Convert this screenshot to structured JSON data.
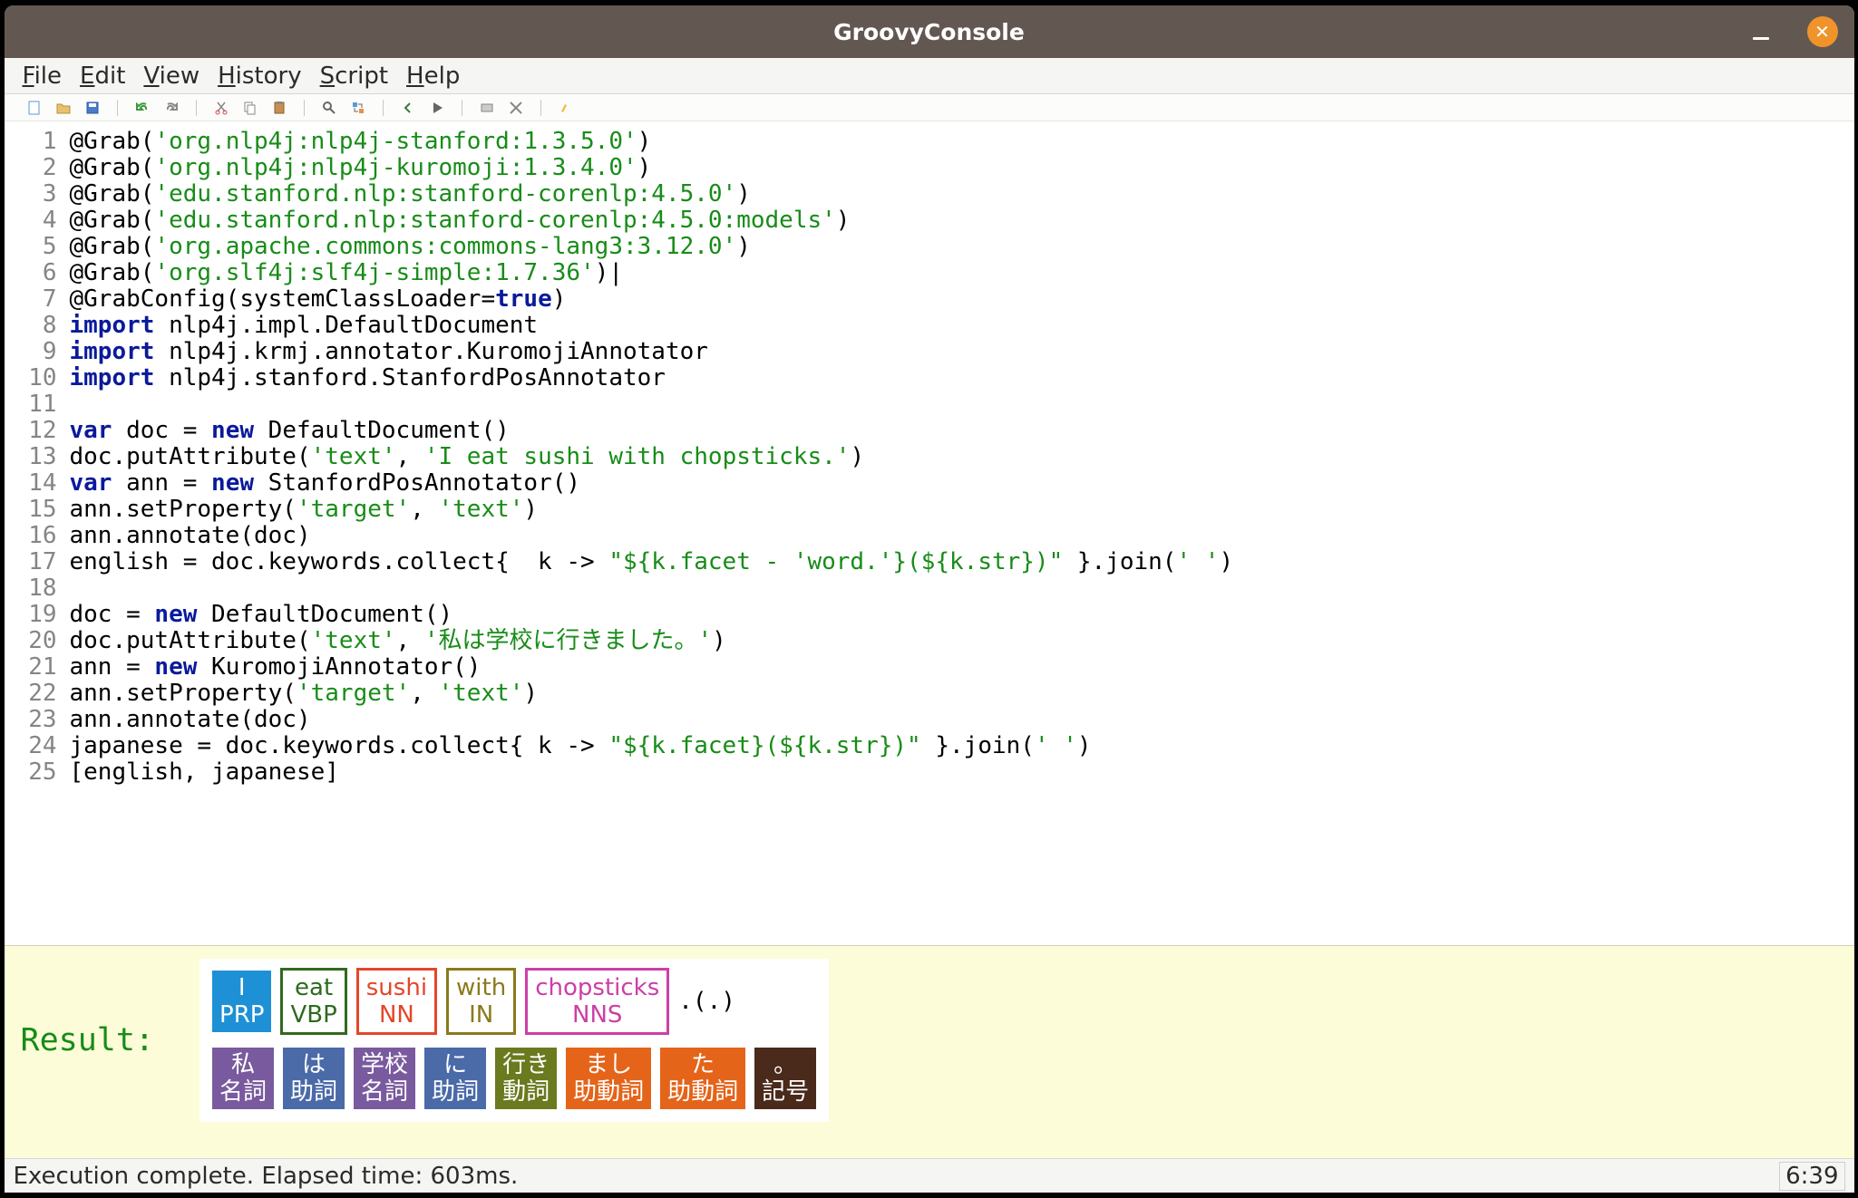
{
  "window": {
    "title": "GroovyConsole"
  },
  "menu": {
    "file": "File",
    "edit": "Edit",
    "view": "View",
    "history": "History",
    "script": "Script",
    "help": "Help"
  },
  "toolbar_icons": [
    "new",
    "open",
    "save",
    "undo",
    "redo",
    "cut",
    "copy",
    "paste",
    "find",
    "replace",
    "run-prev",
    "run",
    "interrupt",
    "clear",
    "inspect"
  ],
  "code_lines": [
    [
      [
        "@Grab(",
        ""
      ],
      [
        "'org.nlp4j:nlp4j-stanford:1.3.5.0'",
        "str"
      ],
      [
        ")",
        ""
      ]
    ],
    [
      [
        "@Grab(",
        ""
      ],
      [
        "'org.nlp4j:nlp4j-kuromoji:1.3.4.0'",
        "str"
      ],
      [
        ")",
        ""
      ]
    ],
    [
      [
        "@Grab(",
        ""
      ],
      [
        "'edu.stanford.nlp:stanford-corenlp:4.5.0'",
        "str"
      ],
      [
        ")",
        ""
      ]
    ],
    [
      [
        "@Grab(",
        ""
      ],
      [
        "'edu.stanford.nlp:stanford-corenlp:4.5.0:models'",
        "str"
      ],
      [
        ")",
        ""
      ]
    ],
    [
      [
        "@Grab(",
        ""
      ],
      [
        "'org.apache.commons:commons-lang3:3.12.0'",
        "str"
      ],
      [
        ")",
        ""
      ]
    ],
    [
      [
        "@Grab(",
        ""
      ],
      [
        "'org.slf4j:slf4j-simple:1.7.36'",
        "str"
      ],
      [
        ")|",
        ""
      ]
    ],
    [
      [
        "@GrabConfig(systemClassLoader=",
        ""
      ],
      [
        "true",
        "bool"
      ],
      [
        ")",
        ""
      ]
    ],
    [
      [
        "import",
        "kw"
      ],
      [
        " nlp4j.impl.DefaultDocument",
        ""
      ]
    ],
    [
      [
        "import",
        "kw"
      ],
      [
        " nlp4j.krmj.annotator.KuromojiAnnotator",
        ""
      ]
    ],
    [
      [
        "import",
        "kw"
      ],
      [
        " nlp4j.stanford.StanfordPosAnnotator",
        ""
      ]
    ],
    [
      [
        "",
        ""
      ]
    ],
    [
      [
        "var",
        "kw"
      ],
      [
        " doc = ",
        ""
      ],
      [
        "new",
        "kw"
      ],
      [
        " DefaultDocument()",
        ""
      ]
    ],
    [
      [
        "doc.putAttribute(",
        ""
      ],
      [
        "'text'",
        "str"
      ],
      [
        ", ",
        ""
      ],
      [
        "'I eat sushi with chopsticks.'",
        "str"
      ],
      [
        ")",
        ""
      ]
    ],
    [
      [
        "var",
        "kw"
      ],
      [
        " ann = ",
        ""
      ],
      [
        "new",
        "kw"
      ],
      [
        " StanfordPosAnnotator()",
        ""
      ]
    ],
    [
      [
        "ann.setProperty(",
        ""
      ],
      [
        "'target'",
        "str"
      ],
      [
        ", ",
        ""
      ],
      [
        "'text'",
        "str"
      ],
      [
        ")",
        ""
      ]
    ],
    [
      [
        "ann.annotate(doc)",
        ""
      ]
    ],
    [
      [
        "english = doc.keywords.collect{  k -> ",
        ""
      ],
      [
        "\"${k.facet - 'word.'}(${k.str})\"",
        "str"
      ],
      [
        " }.join(",
        ""
      ],
      [
        "' '",
        "str"
      ],
      [
        ")",
        ""
      ]
    ],
    [
      [
        "",
        ""
      ]
    ],
    [
      [
        "doc = ",
        ""
      ],
      [
        "new",
        "kw"
      ],
      [
        " DefaultDocument()",
        ""
      ]
    ],
    [
      [
        "doc.putAttribute(",
        ""
      ],
      [
        "'text'",
        "str"
      ],
      [
        ", ",
        ""
      ],
      [
        "'私は学校に行きました。'",
        "str"
      ],
      [
        ")",
        ""
      ]
    ],
    [
      [
        "ann = ",
        ""
      ],
      [
        "new",
        "kw"
      ],
      [
        " KuromojiAnnotator()",
        ""
      ]
    ],
    [
      [
        "ann.setProperty(",
        ""
      ],
      [
        "'target'",
        "str"
      ],
      [
        ", ",
        ""
      ],
      [
        "'text'",
        "str"
      ],
      [
        ")",
        ""
      ]
    ],
    [
      [
        "ann.annotate(doc)",
        ""
      ]
    ],
    [
      [
        "japanese = doc.keywords.collect{ k -> ",
        ""
      ],
      [
        "\"${k.facet}(${k.str})\"",
        "str"
      ],
      [
        " }.join(",
        ""
      ],
      [
        "' '",
        "str"
      ],
      [
        ")",
        ""
      ]
    ],
    [
      [
        "[english, japanese]",
        ""
      ]
    ]
  ],
  "result": {
    "label": "Result:",
    "english": [
      {
        "word": "I",
        "tag": "PRP",
        "color": "#1e90d6",
        "variant": "filled"
      },
      {
        "word": "eat",
        "tag": "VBP",
        "color": "#2e6b1e",
        "variant": "border"
      },
      {
        "word": "sushi",
        "tag": "NN",
        "color": "#e4462a",
        "variant": "border"
      },
      {
        "word": "with",
        "tag": "IN",
        "color": "#8a7a1a",
        "variant": "border"
      },
      {
        "word": "chopsticks",
        "tag": "NNS",
        "color": "#cc3fa7",
        "variant": "border"
      }
    ],
    "period": ".(.)",
    "japanese": [
      {
        "word": "私",
        "tag": "名詞",
        "color": "#7a5a9e",
        "variant": "filled"
      },
      {
        "word": "は",
        "tag": "助詞",
        "color": "#4a6aa8",
        "variant": "filled"
      },
      {
        "word": "学校",
        "tag": "名詞",
        "color": "#7a5a9e",
        "variant": "filled"
      },
      {
        "word": "に",
        "tag": "助詞",
        "color": "#4a6aa8",
        "variant": "filled"
      },
      {
        "word": "行き",
        "tag": "動詞",
        "color": "#6a7a1e",
        "variant": "filled"
      },
      {
        "word": "まし",
        "tag": "助動詞",
        "color": "#e4641a",
        "variant": "filled"
      },
      {
        "word": "た",
        "tag": "助動詞",
        "color": "#e4641a",
        "variant": "filled"
      },
      {
        "word": "。",
        "tag": "記号",
        "color": "#4a2a1a",
        "variant": "filled"
      }
    ]
  },
  "status": {
    "message": "Execution complete. Elapsed time: 603ms.",
    "position": "6:39"
  }
}
